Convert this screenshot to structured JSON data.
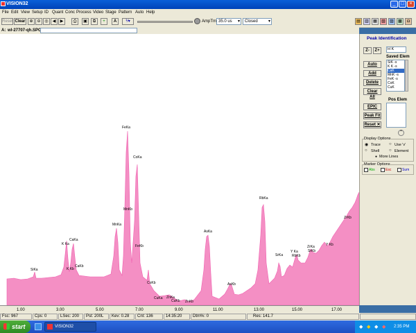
{
  "window": {
    "title": "VISION32"
  },
  "menu": [
    "File",
    "Edit",
    "View",
    "Setup",
    "ID",
    "Quant",
    "Conc",
    "Process",
    "Video",
    "Stage",
    "Pattern",
    "Auto",
    "Help"
  ],
  "toolbar": {
    "reset_label": "Reset",
    "clear_label": "Clear",
    "text_a": "A",
    "amp_label": "AmpTm",
    "amp_value": "35.0 us",
    "mode_value": "Closed"
  },
  "file": {
    "label": "A:",
    "name": "wl-27707-qh.SPC"
  },
  "spectrum": {
    "x_ticks": [
      "1.00",
      "3.00",
      "5.00",
      "7.00",
      "9.00",
      "11.00",
      "13.00",
      "15.00",
      "17.00"
    ],
    "peaks": [
      "SiKa",
      "K Ka",
      "CaKa",
      "K Kb",
      "CaKb",
      "MnKa",
      "FeKa",
      "MnKb",
      "CoKa",
      "FeKb",
      "CoKb",
      "CuKa",
      "ZnKa",
      "CuKb",
      "ZnKb",
      "AsKa",
      "AsKb",
      "RbKa",
      "SrKa",
      "Y Ka",
      "RbKb",
      "ZrKa",
      "SrKb",
      "Y Kb",
      "ZrKb"
    ]
  },
  "panel": {
    "title": "Peak Identification",
    "z_minus": "Z-",
    "z_plus": "Z+",
    "element": "H K",
    "saved_elem_label": "Saved Elem",
    "saved_elem_items": [
      "SiK -s",
      "K K -s",
      "CaK",
      "MnK -s",
      "FeK -s",
      "CoK",
      "CuK"
    ],
    "auto": "Auto",
    "add": "Add",
    "delete": "Delete",
    "clear_all": "Clear All",
    "epic": "EPIC",
    "peak_fit": "Peak Fit",
    "reset": "Reset ✕",
    "pos_elem_label": "Pos Elem",
    "display_options": "Display Options",
    "trace": "Trace",
    "use_v": "Use 'v'",
    "shell": "Shell",
    "element_opt": "Element",
    "more_lines": "More Lines",
    "marker_options": "Marker Options",
    "marker_1": "Abs",
    "marker_2": "Esc",
    "marker_3": "Sum"
  },
  "status": {
    "fsc": "Fsc: 967",
    "cps": "Cps: 0",
    "lsec": "LSec: 200",
    "psht": "Pst: 200L",
    "kev": "Kev: 0.28",
    "cnt": "Cnt: 136",
    "time": "14:35:20",
    "dtm": "Dtm%: 0",
    "res": "Res: 141.7"
  },
  "taskbar": {
    "start": "start",
    "task": "VISION32",
    "clock": "2:35 PM"
  },
  "colors": {
    "spectrum": "#f48fc4",
    "plot_bg": "#ffffff",
    "panel_title": "#0000aa"
  }
}
